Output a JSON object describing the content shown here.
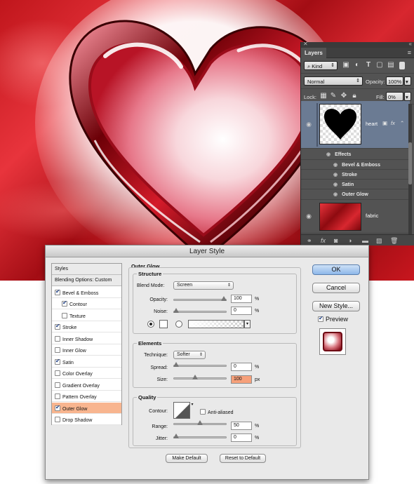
{
  "layers_panel": {
    "tab": "Layers",
    "filter": "Kind",
    "blend_mode": "Normal",
    "opacity_label": "Opacity:",
    "opacity_value": "100%",
    "lock_label": "Lock:",
    "fill_label": "Fill:",
    "fill_value": "0%",
    "layers": [
      {
        "name": "heart",
        "fx": "fx",
        "effects_label": "Effects",
        "effects": [
          "Bevel & Emboss",
          "Stroke",
          "Satin",
          "Outer Glow"
        ]
      },
      {
        "name": "fabric"
      }
    ],
    "footer_fx": "fx"
  },
  "dialog": {
    "title": "Layer Style",
    "style_list": [
      {
        "label": "Styles",
        "type": "header"
      },
      {
        "label": "Blending Options: Custom",
        "type": "header"
      },
      {
        "label": "Bevel & Emboss",
        "checked": true
      },
      {
        "label": "Contour",
        "checked": true,
        "indent": true
      },
      {
        "label": "Texture",
        "checked": false,
        "indent": true
      },
      {
        "label": "Stroke",
        "checked": true
      },
      {
        "label": "Inner Shadow",
        "checked": false
      },
      {
        "label": "Inner Glow",
        "checked": false
      },
      {
        "label": "Satin",
        "checked": true
      },
      {
        "label": "Color Overlay",
        "checked": false
      },
      {
        "label": "Gradient Overlay",
        "checked": false
      },
      {
        "label": "Pattern Overlay",
        "checked": false
      },
      {
        "label": "Outer Glow",
        "checked": true,
        "selected": true
      },
      {
        "label": "Drop Shadow",
        "checked": false
      }
    ],
    "panel_title": "Outer Glow",
    "structure": {
      "title": "Structure",
      "blend_mode_label": "Blend Mode:",
      "blend_mode": "Screen",
      "opacity_label": "Opacity:",
      "opacity": "100",
      "opacity_level": 1.0,
      "noise_label": "Noise:",
      "noise": "0",
      "noise_level": 0.0,
      "unit": "%"
    },
    "elements": {
      "title": "Elements",
      "technique_label": "Technique:",
      "technique": "Softer",
      "spread_label": "Spread:",
      "spread": "0",
      "spread_level": 0.0,
      "size_label": "Size:",
      "size": "100",
      "size_level": 0.4,
      "size_unit": "px"
    },
    "quality": {
      "title": "Quality",
      "contour_label": "Contour:",
      "anti_aliased": "Anti-aliased",
      "range_label": "Range:",
      "range": "50",
      "range_level": 0.5,
      "jitter_label": "Jitter:",
      "jitter": "0",
      "jitter_level": 0.0
    },
    "make_default": "Make Default",
    "reset_default": "Reset to Default",
    "ok": "OK",
    "cancel": "Cancel",
    "new_style": "New Style...",
    "preview": "Preview",
    "colors": {
      "selected_row": "#f8b58f",
      "glow_color": "#ffffff",
      "ok_button": "#8db7ea"
    }
  }
}
